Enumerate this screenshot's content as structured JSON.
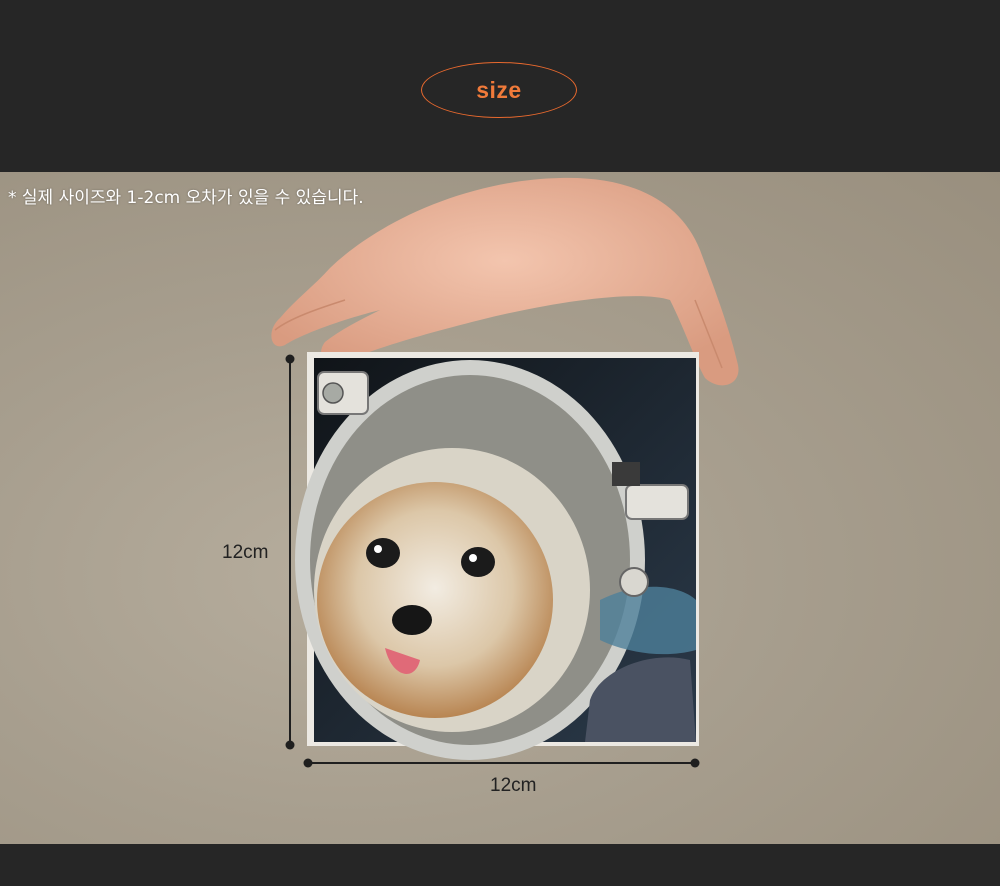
{
  "header": {
    "title": "size"
  },
  "note": "* 실제 사이즈와 1-2cm 오차가 있을 수 있습니다.",
  "dimensions": {
    "height": "12cm",
    "width": "12cm"
  },
  "colors": {
    "accent": "#e8692e",
    "background_dark": "#262626"
  }
}
